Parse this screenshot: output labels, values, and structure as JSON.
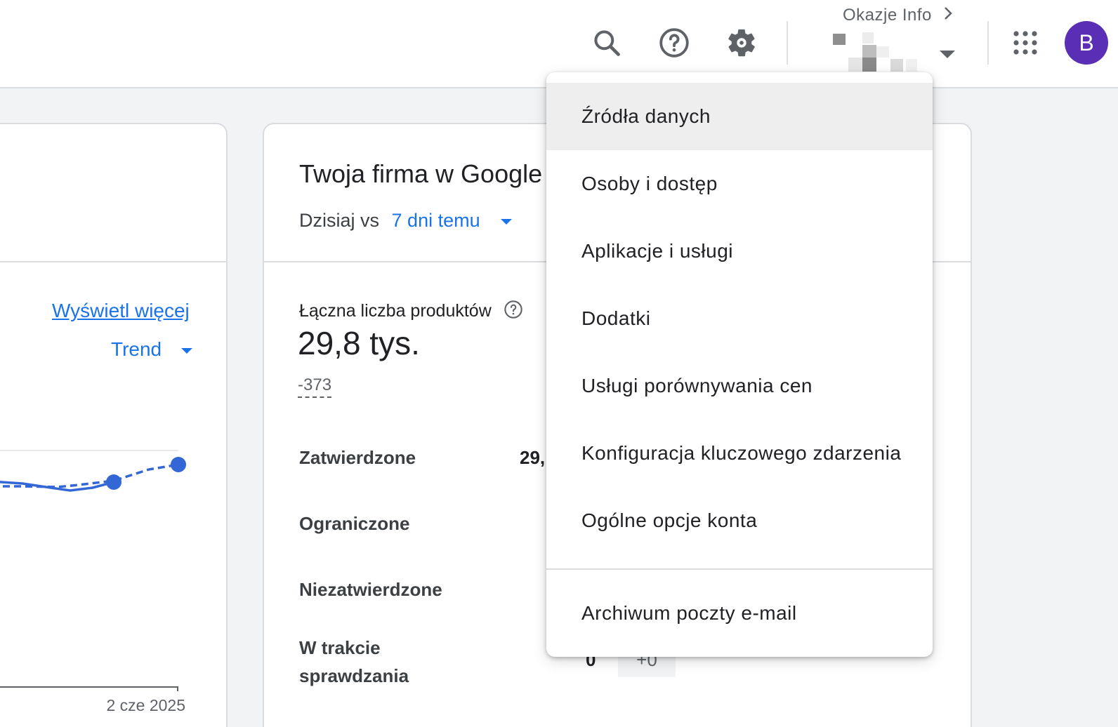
{
  "header": {
    "account_label": "Okazje Info",
    "avatar_letter": "B"
  },
  "left_card": {
    "view_more": "Wyświetl więcej",
    "trend_label": "Trend",
    "date_label": "2 cze 2025",
    "line_color": "#3367d6"
  },
  "main_card": {
    "title": "Twoja firma w Google",
    "compare_prefix": "Dzisiaj vs",
    "compare_value": "7 dni temu",
    "total_label": "Łączna liczba produktów",
    "total_value": "29,8 tys.",
    "total_change": "-373",
    "rows": [
      {
        "label": "Zatwierdzone",
        "value": "29,"
      },
      {
        "label": "Ograniczone"
      },
      {
        "label": "Niezatwierdzone"
      },
      {
        "label_line1": "W trakcie",
        "label_line2": "sprawdzania",
        "value": "0",
        "change": "+0"
      }
    ]
  },
  "settings_menu": {
    "items": [
      {
        "label": "Źródła danych",
        "active": true
      },
      {
        "label": "Osoby i dostęp"
      },
      {
        "label": "Aplikacje i usługi"
      },
      {
        "label": "Dodatki"
      },
      {
        "label": "Usługi porównywania cen"
      },
      {
        "label": "Konfiguracja kluczowego zdarzenia"
      },
      {
        "label": "Ogólne opcje konta"
      }
    ],
    "footer_item": "Archiwum poczty e-mail"
  },
  "colors": {
    "accent": "#1a73e8",
    "avatar": "#5b2fb5"
  }
}
